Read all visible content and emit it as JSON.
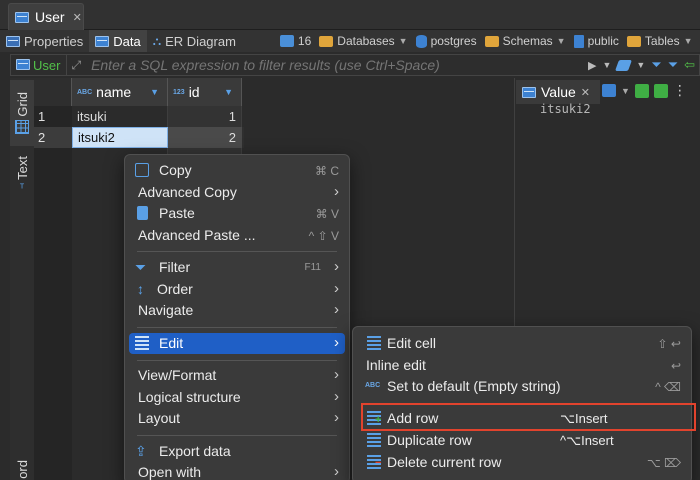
{
  "editor": {
    "tab_title": "User"
  },
  "subtabs": {
    "properties": "Properties",
    "data": "Data",
    "er_diagram": "ER Diagram"
  },
  "breadcrumbs": {
    "count": "16",
    "databases": "Databases",
    "postgres": "postgres",
    "schemas": "Schemas",
    "public": "public",
    "tables": "Tables"
  },
  "filter": {
    "label": "User",
    "placeholder": "Enter a SQL expression to filter results (use Ctrl+Space)"
  },
  "side_tabs": {
    "grid": "Grid",
    "text": "Text",
    "record": "ord"
  },
  "grid": {
    "columns": [
      {
        "type_badge": "ABC",
        "name": "name"
      },
      {
        "type_badge": "123",
        "name": "id"
      }
    ],
    "rows": [
      {
        "num": "1",
        "name": "itsuki",
        "id": "1"
      },
      {
        "num": "2",
        "name": "itsuki2",
        "id": "2"
      }
    ]
  },
  "value_panel": {
    "title": "Value",
    "content": "itsuki2"
  },
  "context_menu": {
    "copy": "Copy",
    "copy_sc": "⌘ C",
    "advanced_copy": "Advanced Copy",
    "paste": "Paste",
    "paste_sc": "⌘ V",
    "advanced_paste": "Advanced Paste ...",
    "advanced_paste_sc": "^ ⇧ V",
    "filter": "Filter",
    "filter_sc": "F11",
    "order": "Order",
    "navigate": "Navigate",
    "edit": "Edit",
    "view_format": "View/Format",
    "logical_structure": "Logical structure",
    "layout": "Layout",
    "export_data": "Export data",
    "open_with": "Open with"
  },
  "edit_submenu": {
    "edit_cell": "Edit cell",
    "edit_cell_sc": "⇧ ↩",
    "inline_edit": "Inline edit",
    "inline_edit_sc": "↩",
    "set_default": "Set to default (Empty string)",
    "set_default_sc": "^ ⌫",
    "add_row": "Add row",
    "add_row_sc": "⌥Insert",
    "duplicate_row": "Duplicate row",
    "duplicate_row_sc": "^⌥Insert",
    "delete_row": "Delete current row",
    "delete_row_sc": "⌥ ⌦"
  },
  "colors": {
    "accent": "#1f5fc6",
    "selection_cell": "#cfe3f7",
    "highlight_box": "#e2432d",
    "filter_label": "#52c049"
  }
}
